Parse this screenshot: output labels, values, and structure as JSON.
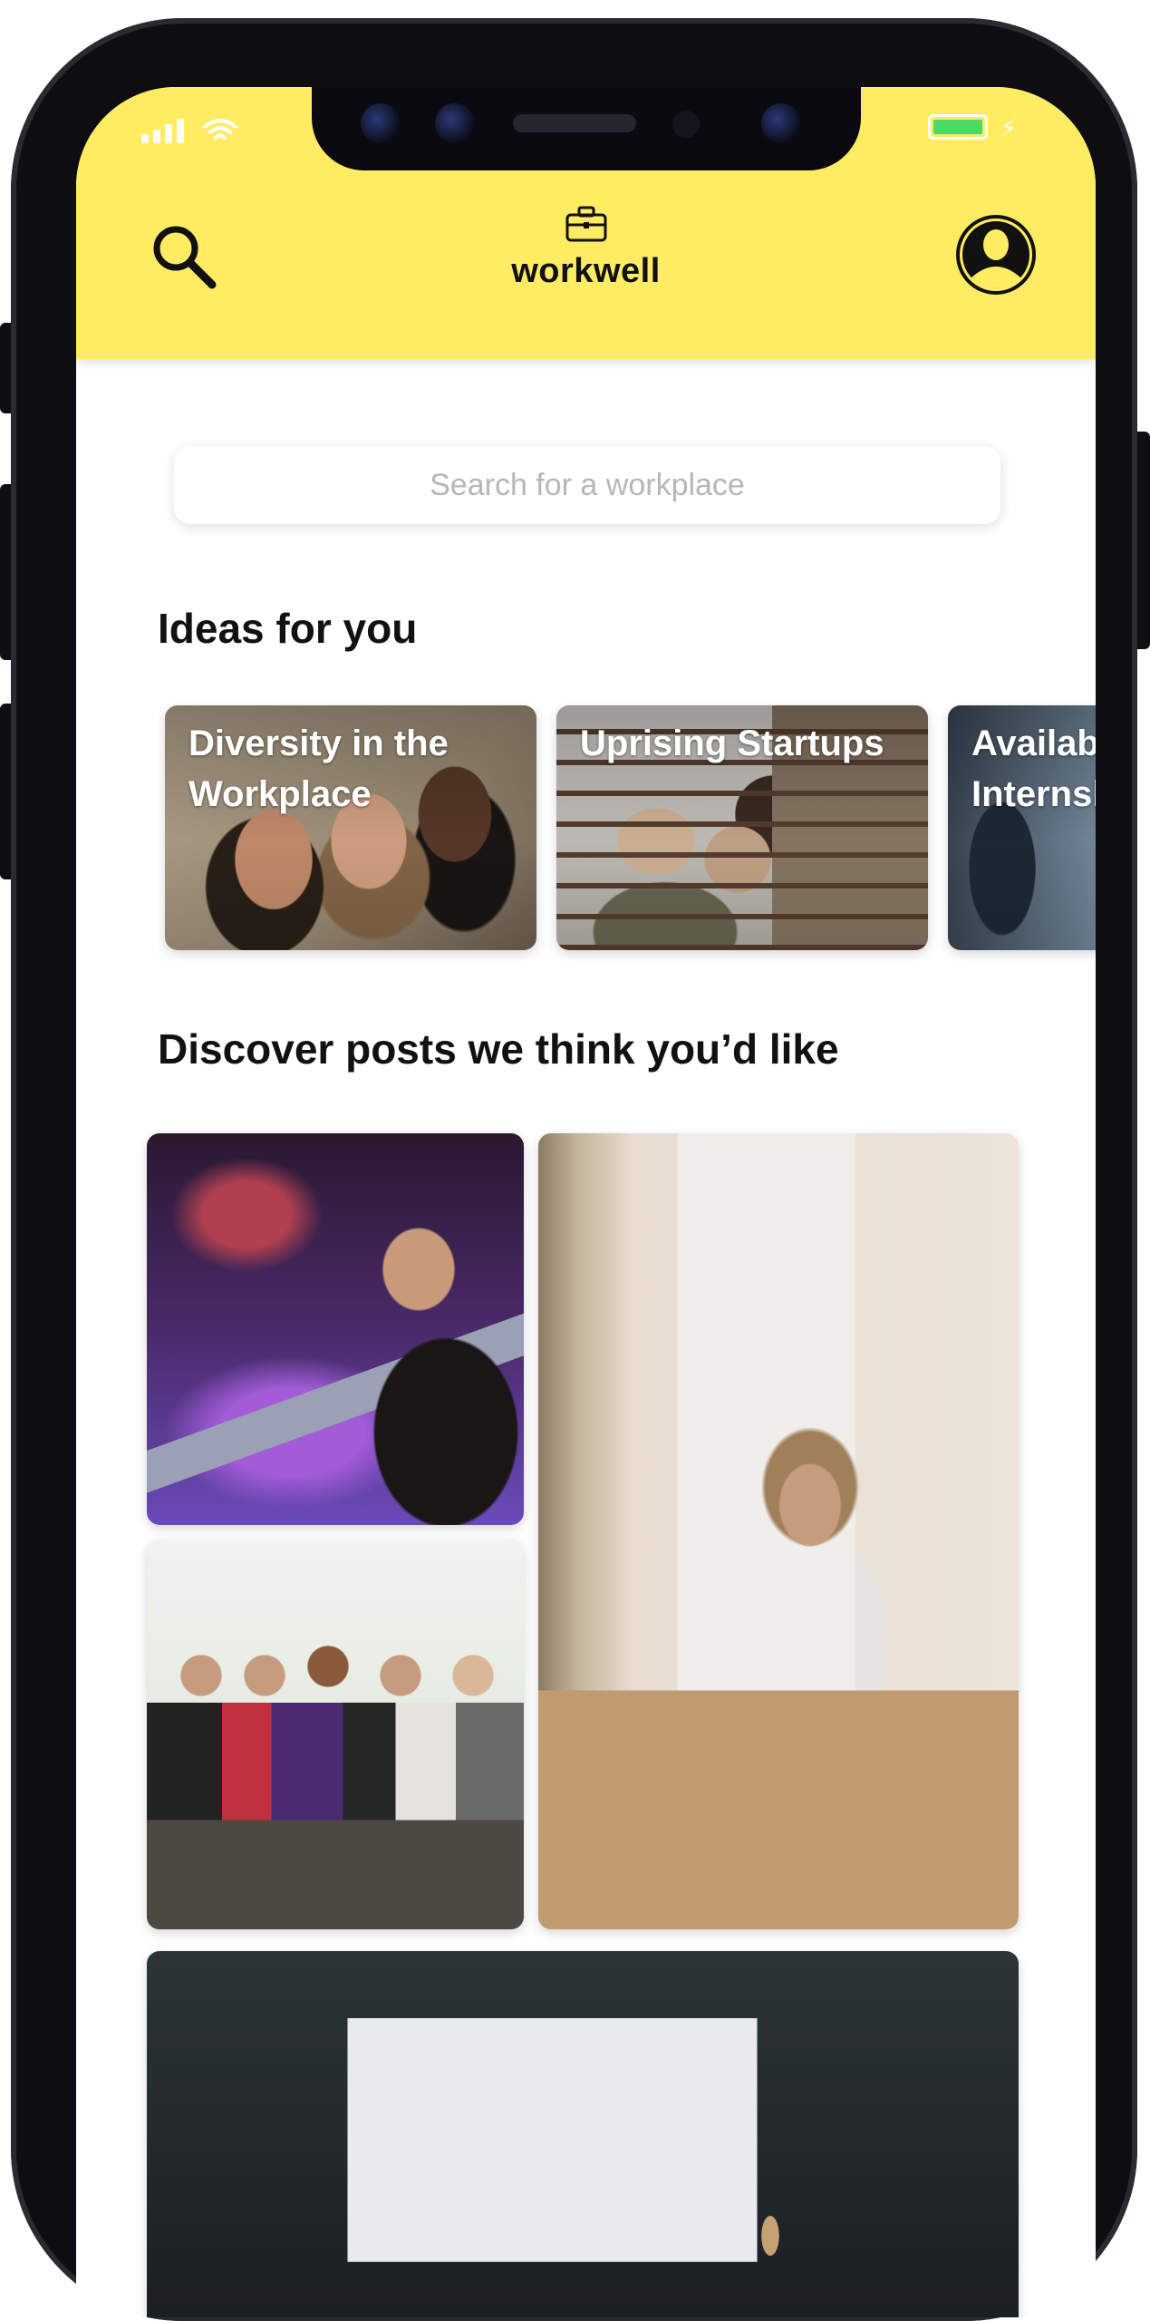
{
  "app": {
    "name": "workwell"
  },
  "header": {
    "search_icon": "search-icon",
    "logo_icon": "briefcase-icon",
    "profile_icon": "user-avatar-icon"
  },
  "status_bar": {
    "signal_icon": "signal-bars-icon",
    "wifi_icon": "wifi-icon",
    "battery_icon": "battery-charging-icon",
    "battery_color": "#4cd964"
  },
  "search": {
    "placeholder": "Search for a workplace"
  },
  "ideas": {
    "title": "Ideas for you",
    "cards": [
      {
        "label": "Diversity in the Workplace"
      },
      {
        "label": "Uprising Startups"
      },
      {
        "label": "Available Internships"
      }
    ]
  },
  "discover": {
    "title": "Discover posts we think you’d like"
  },
  "theme": {
    "accent": "#ffec62",
    "text": "#111111",
    "placeholder": "#b7b7b7"
  }
}
